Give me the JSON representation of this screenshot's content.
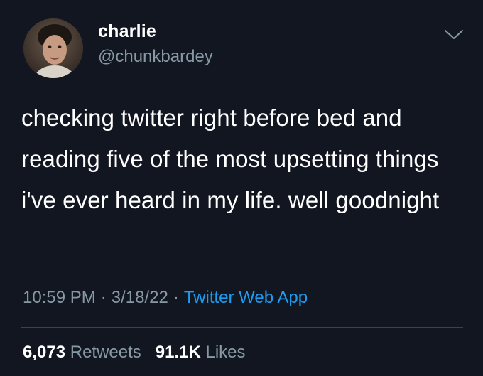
{
  "author": {
    "display_name": "charlie",
    "handle": "@chunkbardey"
  },
  "icons": {
    "menu_caret": "chevron-down-icon",
    "avatar": "profile-photo"
  },
  "tweet": {
    "text": "checking twitter right before bed and reading five of the most upsetting things i've ever heard in my life. well goodnight",
    "time": "10:59 PM",
    "date": "3/18/22",
    "source": "Twitter Web App",
    "separator": "·"
  },
  "stats": {
    "retweets_count": "6,073",
    "retweets_label": "Retweets",
    "likes_count": "91.1K",
    "likes_label": "Likes"
  },
  "colors": {
    "background": "#111620",
    "text_primary": "#ffffff",
    "text_secondary": "#8899a6",
    "link": "#1d9bf0",
    "divider": "#38444d"
  }
}
